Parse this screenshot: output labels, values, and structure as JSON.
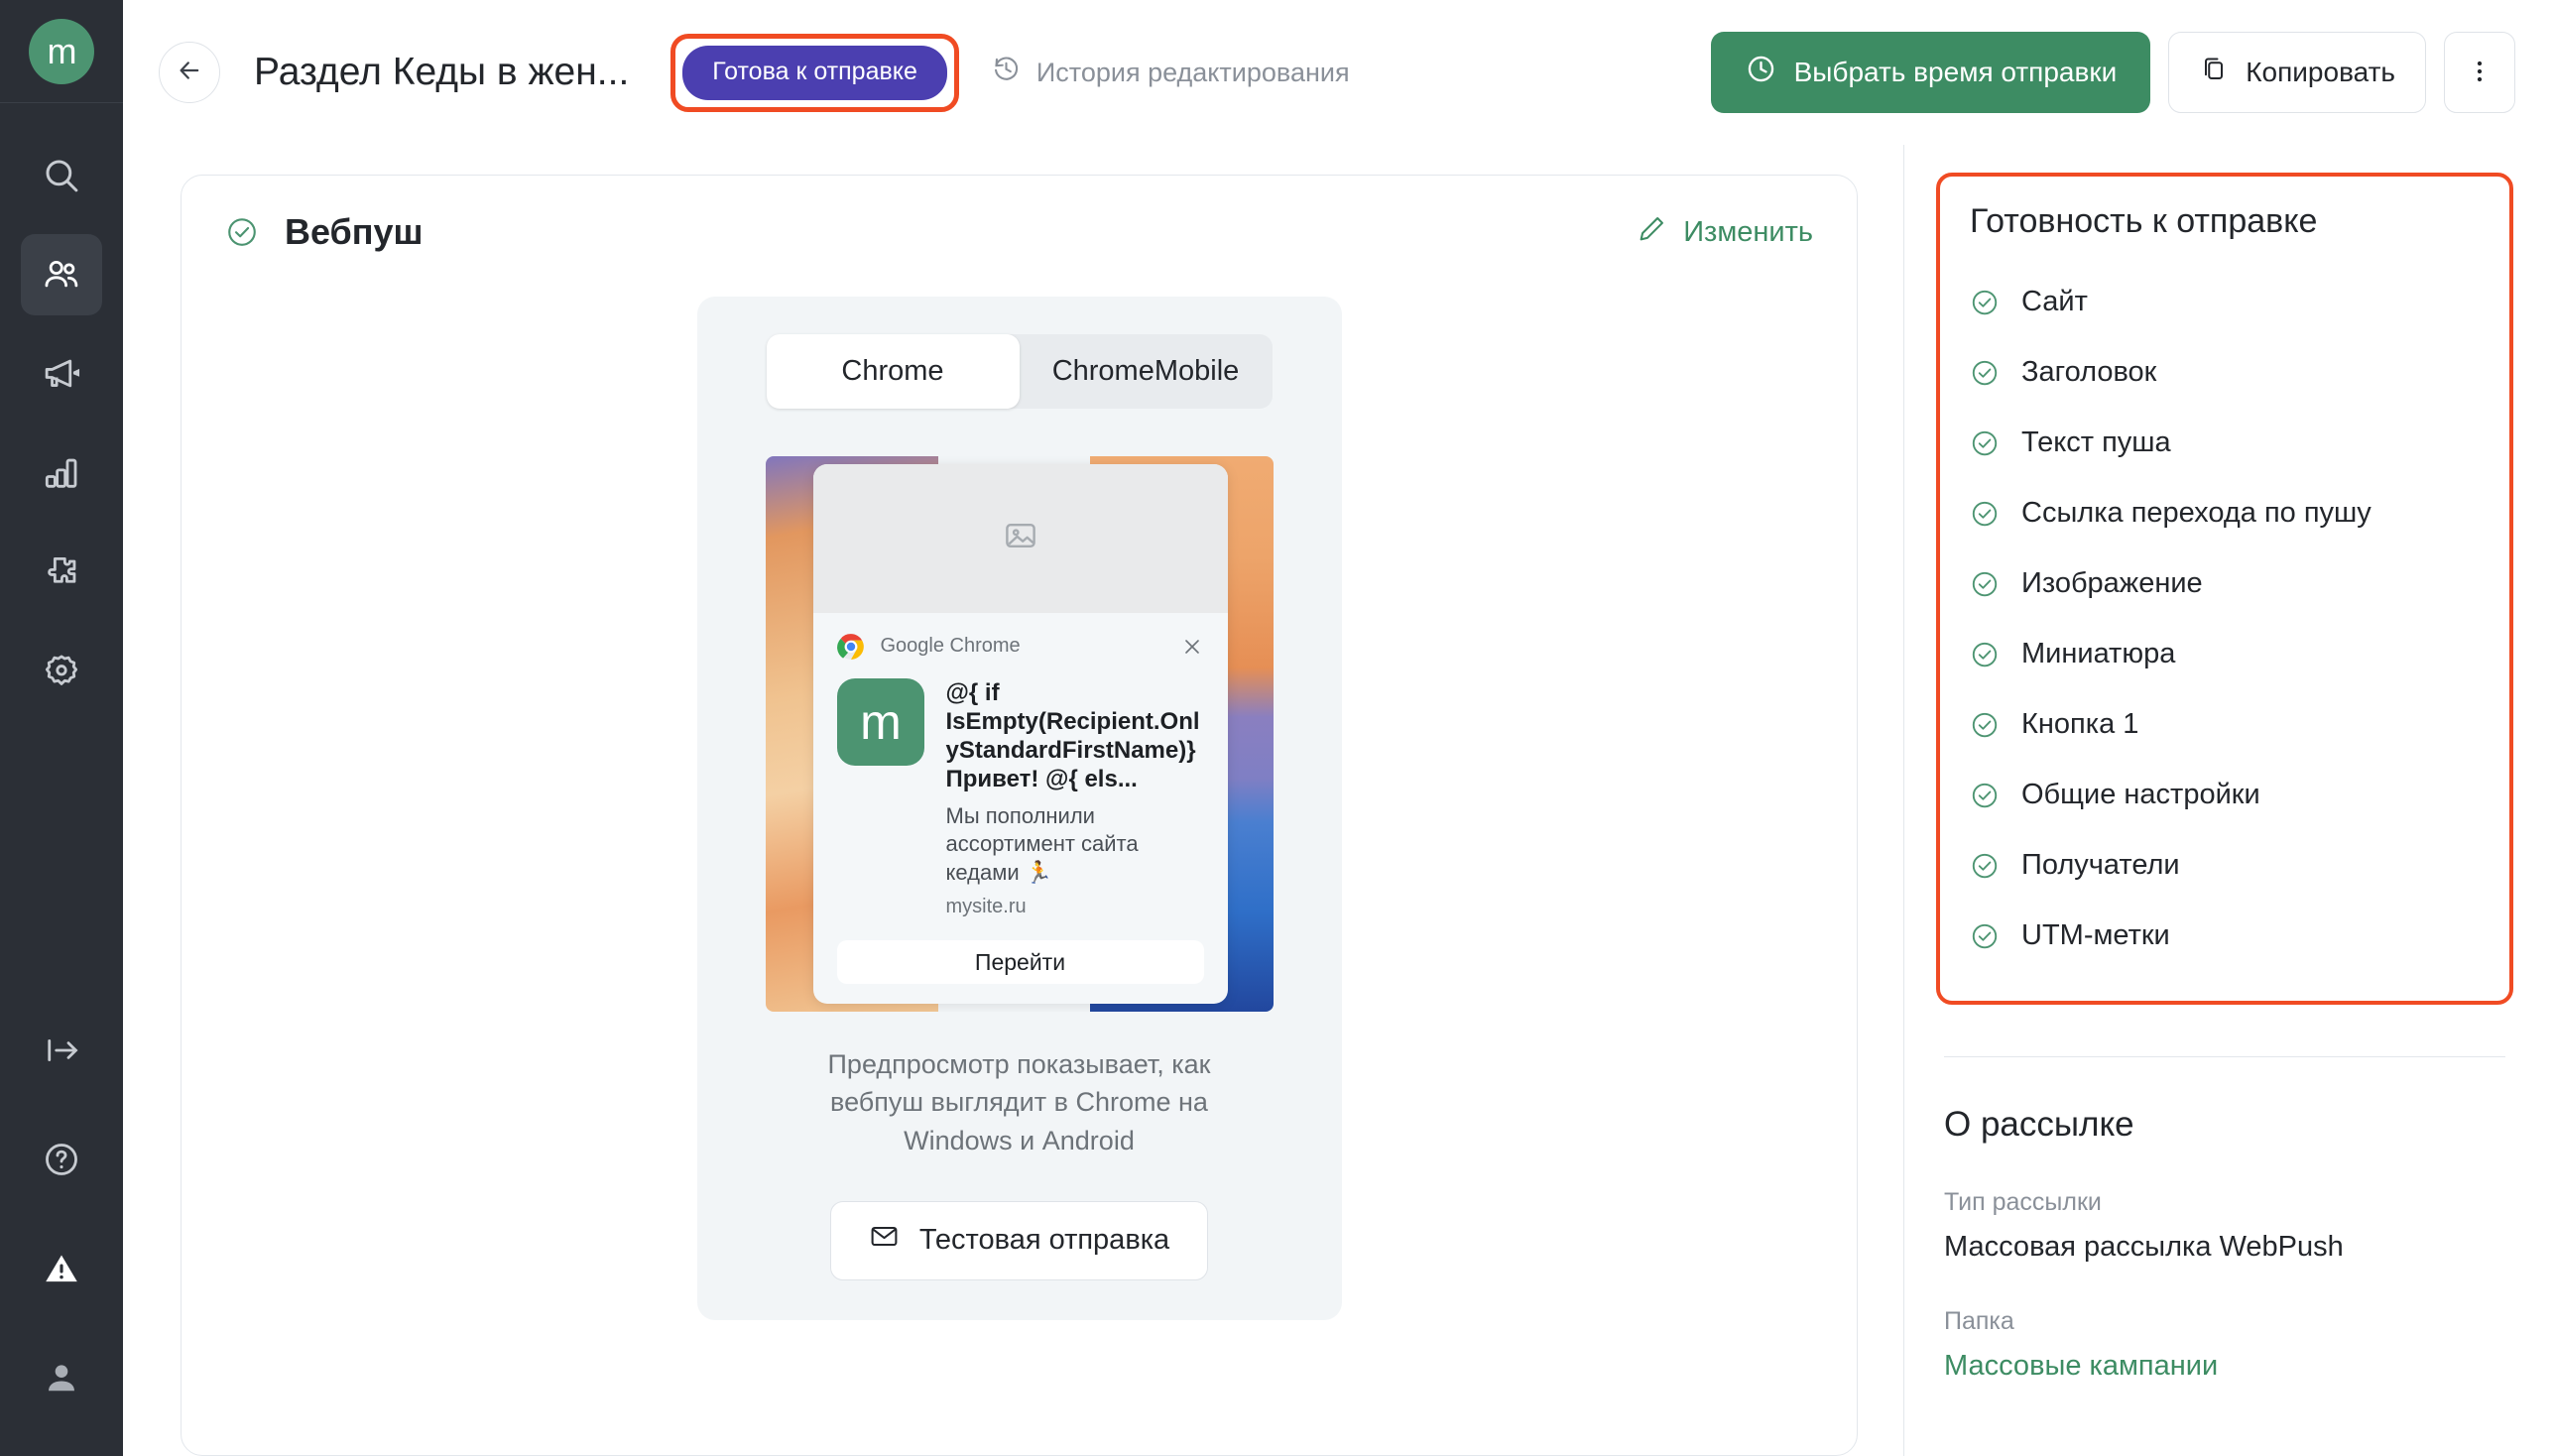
{
  "sidebar": {
    "logo_text": "m",
    "items": [
      {
        "icon": "search-icon",
        "name": "search",
        "active": false
      },
      {
        "icon": "contacts-icon",
        "name": "contacts",
        "active": true
      },
      {
        "icon": "megaphone-icon",
        "name": "campaigns",
        "active": false
      },
      {
        "icon": "bar-chart-icon",
        "name": "analytics",
        "active": false
      },
      {
        "icon": "puzzle-icon",
        "name": "integrations",
        "active": false
      },
      {
        "icon": "gear-icon",
        "name": "settings",
        "active": false
      }
    ],
    "bottom_items": [
      {
        "icon": "logout-icon",
        "name": "logout"
      },
      {
        "icon": "question-icon",
        "name": "help"
      },
      {
        "icon": "warning-icon",
        "name": "alerts"
      },
      {
        "icon": "user-icon",
        "name": "account"
      }
    ]
  },
  "header": {
    "back_icon": "arrow-left-icon",
    "title": "Раздел Кеды в жен...",
    "status_badge": "Готова к отправке",
    "history_icon": "clock-history-icon",
    "history_label": "История редактирования",
    "schedule_icon": "clock-icon",
    "schedule_label": "Выбрать время отправки",
    "copy_icon": "copy-icon",
    "copy_label": "Копировать",
    "more_icon": "more-vertical-icon"
  },
  "card": {
    "status_icon": "check-circle-icon",
    "title": "Вебпуш",
    "edit_icon": "pencil-icon",
    "edit_label": "Изменить"
  },
  "preview": {
    "tabs": [
      {
        "label": "Chrome",
        "selected": true
      },
      {
        "label": "ChromeMobile",
        "selected": false
      }
    ],
    "image_placeholder_icon": "image-placeholder-icon",
    "notification": {
      "browser_icon": "chrome-icon",
      "browser_name": "Google Chrome",
      "close_icon": "close-icon",
      "app_icon_letter": "m",
      "title": "@{ if IsEmpty(Recipient.OnlyStandardFirstName)}Привет! @{ els...",
      "body": "Мы пополнили ассортимент сайта кедами 🏃",
      "url": "mysite.ru",
      "action_label": "Перейти"
    },
    "note": "Предпросмотр показывает, как вебпуш выглядит в Chrome на Windows и Android",
    "test_send_icon": "envelope-icon",
    "test_send_label": "Тестовая отправка"
  },
  "right_panel": {
    "readiness": {
      "title": "Готовность к отправке",
      "items": [
        {
          "label": "Сайт",
          "icon": "check-circle-icon"
        },
        {
          "label": "Заголовок",
          "icon": "check-circle-icon"
        },
        {
          "label": "Текст пуша",
          "icon": "check-circle-icon"
        },
        {
          "label": "Ссылка перехода по пушу",
          "icon": "check-circle-icon"
        },
        {
          "label": "Изображение",
          "icon": "check-circle-icon"
        },
        {
          "label": "Миниатюра",
          "icon": "check-circle-icon"
        },
        {
          "label": "Кнопка 1",
          "icon": "check-circle-icon"
        },
        {
          "label": "Общие настройки",
          "icon": "check-circle-icon"
        },
        {
          "label": "Получатели",
          "icon": "check-circle-icon"
        },
        {
          "label": "UTM-метки",
          "icon": "check-circle-icon"
        }
      ]
    },
    "about": {
      "title": "О рассылке",
      "type_label": "Тип рассылки",
      "type_value": "Массовая рассылка WebPush",
      "folder_label": "Папка",
      "folder_value": "Массовые кампании"
    }
  },
  "colors": {
    "brand_green": "#3d8c63",
    "accent_purple": "#4b3fb0",
    "highlight_red": "#f04b23",
    "sidebar_bg": "#2b2f36"
  }
}
